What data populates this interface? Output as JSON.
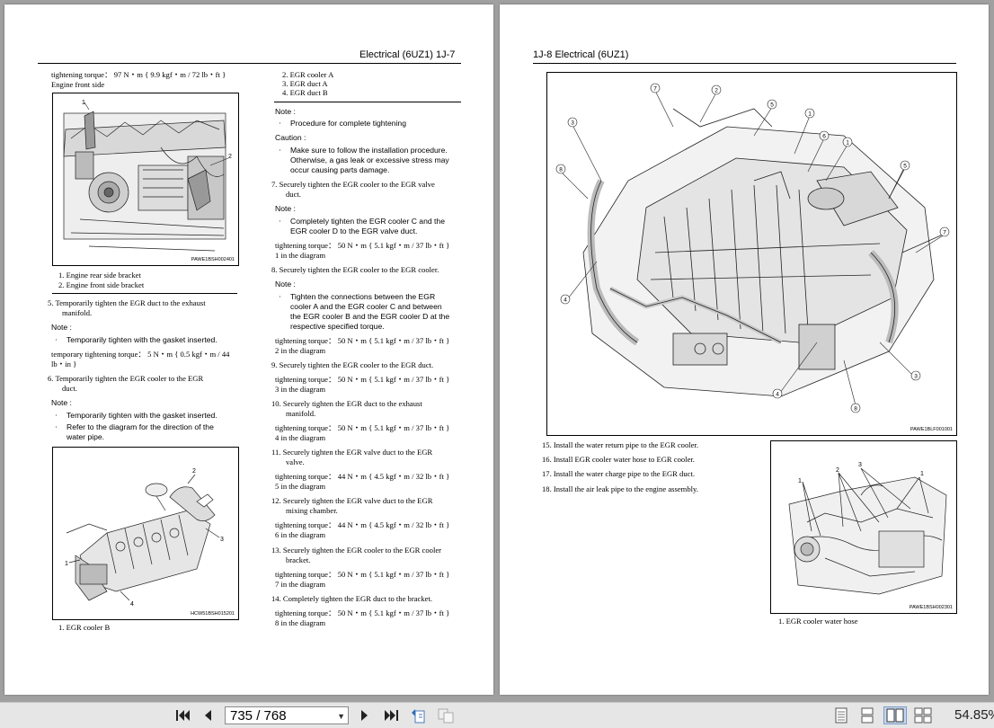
{
  "left_page": {
    "header": "Electrical (6UZ1)   1J-7",
    "col1": {
      "torque_top": "tightening torque： 97 N・m { 9.9 kgf・m / 72 lb・ft }",
      "engine_front_side": "Engine front side",
      "fig1_code": "PAWE1BSH002401",
      "fig1_items": [
        "1.   Engine rear side bracket",
        "2.   Engine front side bracket"
      ],
      "step5": "5.   Temporarily tighten the EGR duct to the exhaust",
      "step5b": "manifold.",
      "note_label": "Note :",
      "note5": "Temporarily tighten with the gasket inserted.",
      "temp_torque_a": "temporary tightening torque： 5 N・m { 0.5 kgf・m / 44",
      "temp_torque_b": "lb・in }",
      "step6": "6.   Temporarily tighten the EGR cooler to the EGR",
      "step6b": "duct.",
      "note6a": "Temporarily tighten with the gasket inserted.",
      "note6b": "Refer to the diagram for the direction of the",
      "note6c": "water pipe.",
      "fig2_code": "HCW51BSH015201",
      "fig2_item": "1.   EGR cooler B"
    },
    "col2": {
      "items": [
        "2.   EGR cooler A",
        "3.   EGR duct A",
        "4.   EGR duct B"
      ],
      "note_label": "Note :",
      "note_a": "Procedure for complete tightening",
      "caution_label": "Caution :",
      "caution_1": "Make sure to follow the installation procedure.",
      "caution_2": "Otherwise, a gas leak or excessive stress may",
      "caution_3": "occur causing parts damage.",
      "step7": "7.   Securely tighten the EGR cooler to the EGR valve",
      "step7b": "duct.",
      "note7_1": "Completely tighten the EGR cooler C and the",
      "note7_2": "EGR cooler D to the EGR valve duct.",
      "t1": "tightening torque： 50 N・m { 5.1 kgf・m / 37 lb・ft }",
      "t1b": "1 in the diagram",
      "step8": "8.   Securely tighten the EGR cooler to the EGR cooler.",
      "note8_1": "Tighten the connections between the EGR",
      "note8_2": "cooler A and the EGR cooler C and between",
      "note8_3": "the EGR cooler B and the EGR cooler D at the",
      "note8_4": "respective specified torque.",
      "t2": "tightening torque： 50 N・m { 5.1 kgf・m / 37 lb・ft }",
      "t2b": "2 in the diagram",
      "step9": "9.   Securely tighten the EGR cooler to the EGR duct.",
      "t3": "tightening torque： 50 N・m { 5.1 kgf・m / 37 lb・ft }",
      "t3b": "3 in the diagram",
      "step10": "10.  Securely tighten the EGR duct to the exhaust",
      "step10b": "manifold.",
      "t4": "tightening torque： 50 N・m { 5.1 kgf・m / 37 lb・ft }",
      "t4b": "4 in the diagram",
      "step11": "11.  Securely tighten the EGR valve duct to the EGR",
      "step11b": "valve.",
      "t5": "tightening torque： 44 N・m { 4.5 kgf・m / 32 lb・ft }",
      "t5b": "5 in the diagram",
      "step12": "12.  Securely tighten the EGR valve duct to the EGR",
      "step12b": "mixing chamber.",
      "t6": "tightening torque： 44 N・m { 4.5 kgf・m / 32 lb・ft }",
      "t6b": "6 in the diagram",
      "step13": "13.  Securely tighten the EGR cooler to the EGR cooler",
      "step13b": "bracket.",
      "t7": "tightening torque： 50 N・m { 5.1 kgf・m / 37 lb・ft }",
      "t7b": "7 in the diagram",
      "step14": "14.  Completely tighten the EGR duct to the bracket.",
      "t8": "tightening torque： 50 N・m { 5.1 kgf・m / 37 lb・ft }",
      "t8b": "8 in the diagram"
    }
  },
  "right_page": {
    "header": "1J-8   Electrical (6UZ1)",
    "fig_main_code": "PAWE1BLF001001",
    "steps": [
      "15.  Install the water return pipe to the EGR cooler.",
      "16.  Install EGR cooler water hose to EGR cooler.",
      "17.  Install the water charge pipe to the EGR duct.",
      "18.  Install the air leak pipe to the engine assembly."
    ],
    "fig_small_code": "PAWE1BSH002301",
    "fig_small_item": "1.   EGR cooler water hose"
  },
  "toolbar": {
    "page_indicator": "735 / 768",
    "zoom": "54.85%"
  }
}
